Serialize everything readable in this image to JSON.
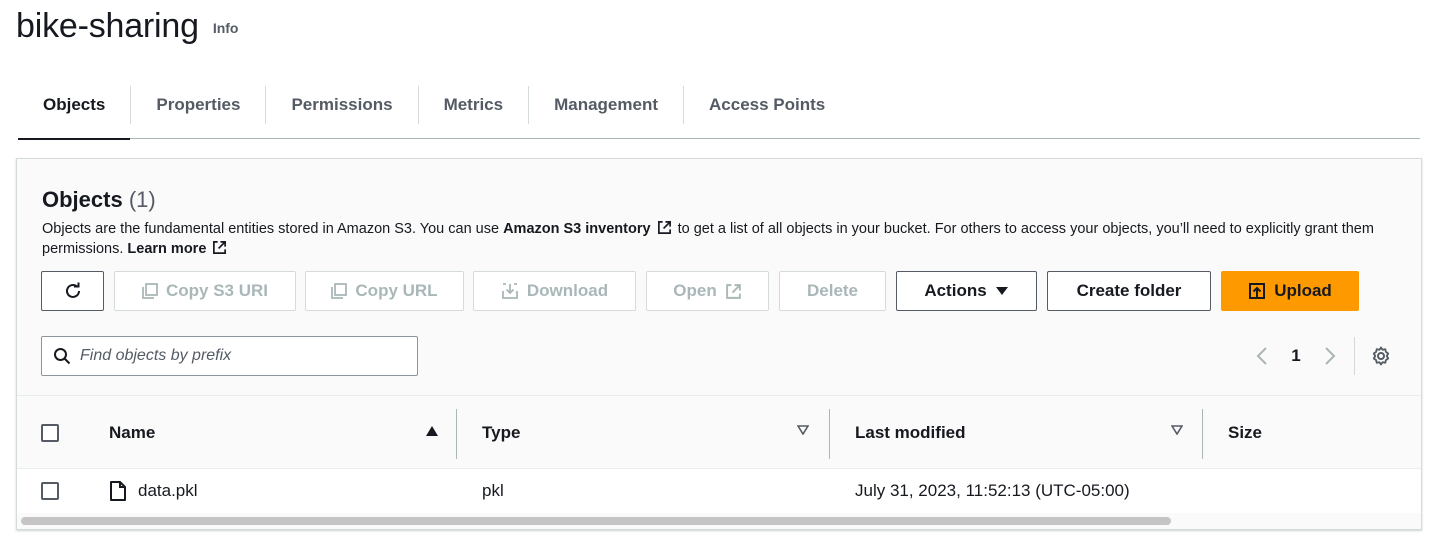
{
  "header": {
    "title": "bike-sharing",
    "info_label": "Info"
  },
  "tabs": [
    {
      "label": "Objects",
      "active": true
    },
    {
      "label": "Properties",
      "active": false
    },
    {
      "label": "Permissions",
      "active": false
    },
    {
      "label": "Metrics",
      "active": false
    },
    {
      "label": "Management",
      "active": false
    },
    {
      "label": "Access Points",
      "active": false
    }
  ],
  "objects_panel": {
    "title": "Objects",
    "count": "(1)",
    "description_part1": "Objects are the fundamental entities stored in Amazon S3. You can use ",
    "inventory_link": "Amazon S3 inventory",
    "description_part2": " to get a list of all objects in your bucket. For others to access your objects, you’ll need to explicitly grant them permissions. ",
    "learn_more_link": "Learn more"
  },
  "toolbar": {
    "refresh_icon": "refresh-icon",
    "copy_s3_uri_label": "Copy S3 URI",
    "copy_url_label": "Copy URL",
    "download_label": "Download",
    "open_label": "Open",
    "delete_label": "Delete",
    "actions_label": "Actions",
    "create_folder_label": "Create folder",
    "upload_label": "Upload"
  },
  "search": {
    "placeholder": "Find objects by prefix",
    "value": ""
  },
  "pagination": {
    "current_page": "1"
  },
  "table": {
    "columns": [
      "Name",
      "Type",
      "Last modified",
      "Size"
    ],
    "rows": [
      {
        "name": "data.pkl",
        "type": "pkl",
        "last_modified": "July 31, 2023, 11:52:13 (UTC-05:00)",
        "size": ""
      }
    ]
  },
  "colors": {
    "primary": "#ff9900",
    "text": "#16191f",
    "muted": "#545b64",
    "disabled": "#aab7b8"
  }
}
